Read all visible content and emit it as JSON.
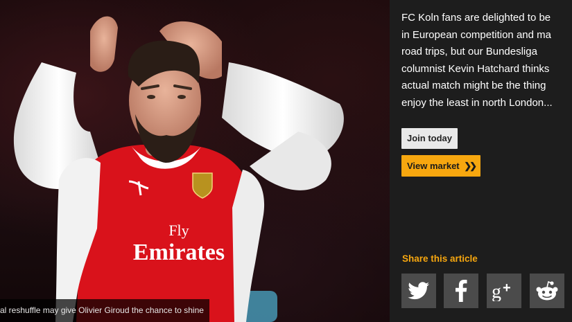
{
  "photo": {
    "caption": "al reshuffle may give Olivier Giroud the chance to shine",
    "shirt_sponsor_line1": "Fly",
    "shirt_sponsor_line2": "Emirates"
  },
  "article": {
    "blurb_lines": [
      "FC Koln fans are delighted to be",
      "in European competition and ma",
      "road trips, but our Bundesliga",
      "columnist Kevin Hatchard thinks",
      "actual match might be the thing",
      "enjoy the least in north London..."
    ],
    "join_label": "Join today",
    "market_label": "View market",
    "market_chevron": "❯❯"
  },
  "share": {
    "label": "Share this article",
    "buttons": [
      {
        "name": "twitter",
        "icon": "twitter-icon"
      },
      {
        "name": "facebook",
        "icon": "facebook-icon",
        "glyph": "f"
      },
      {
        "name": "google-plus",
        "icon": "google-plus-icon",
        "glyph": "g+"
      },
      {
        "name": "reddit",
        "icon": "reddit-icon"
      }
    ]
  },
  "colors": {
    "accent": "#f7a70f",
    "panel_bg": "#1d1d1d",
    "share_tile": "#4b4b4b",
    "shirt_red": "#d9121b"
  }
}
